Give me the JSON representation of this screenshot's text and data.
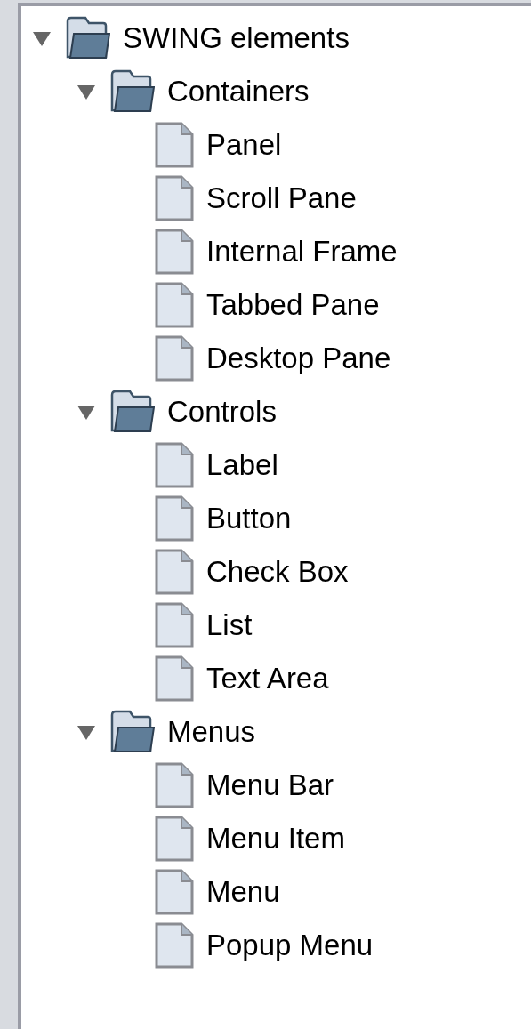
{
  "tree": [
    {
      "label": "SWING elements",
      "expanded": true,
      "children": [
        {
          "label": "Containers",
          "expanded": true,
          "children": [
            {
              "label": "Panel"
            },
            {
              "label": "Scroll Pane"
            },
            {
              "label": "Internal Frame"
            },
            {
              "label": "Tabbed Pane"
            },
            {
              "label": "Desktop Pane"
            }
          ]
        },
        {
          "label": "Controls",
          "expanded": true,
          "children": [
            {
              "label": "Label"
            },
            {
              "label": "Button"
            },
            {
              "label": "Check Box"
            },
            {
              "label": "List"
            },
            {
              "label": "Text Area"
            }
          ]
        },
        {
          "label": "Menus",
          "expanded": true,
          "children": [
            {
              "label": "Menu Bar"
            },
            {
              "label": "Menu Item"
            },
            {
              "label": "Menu"
            },
            {
              "label": "Popup Menu"
            }
          ]
        }
      ]
    }
  ]
}
